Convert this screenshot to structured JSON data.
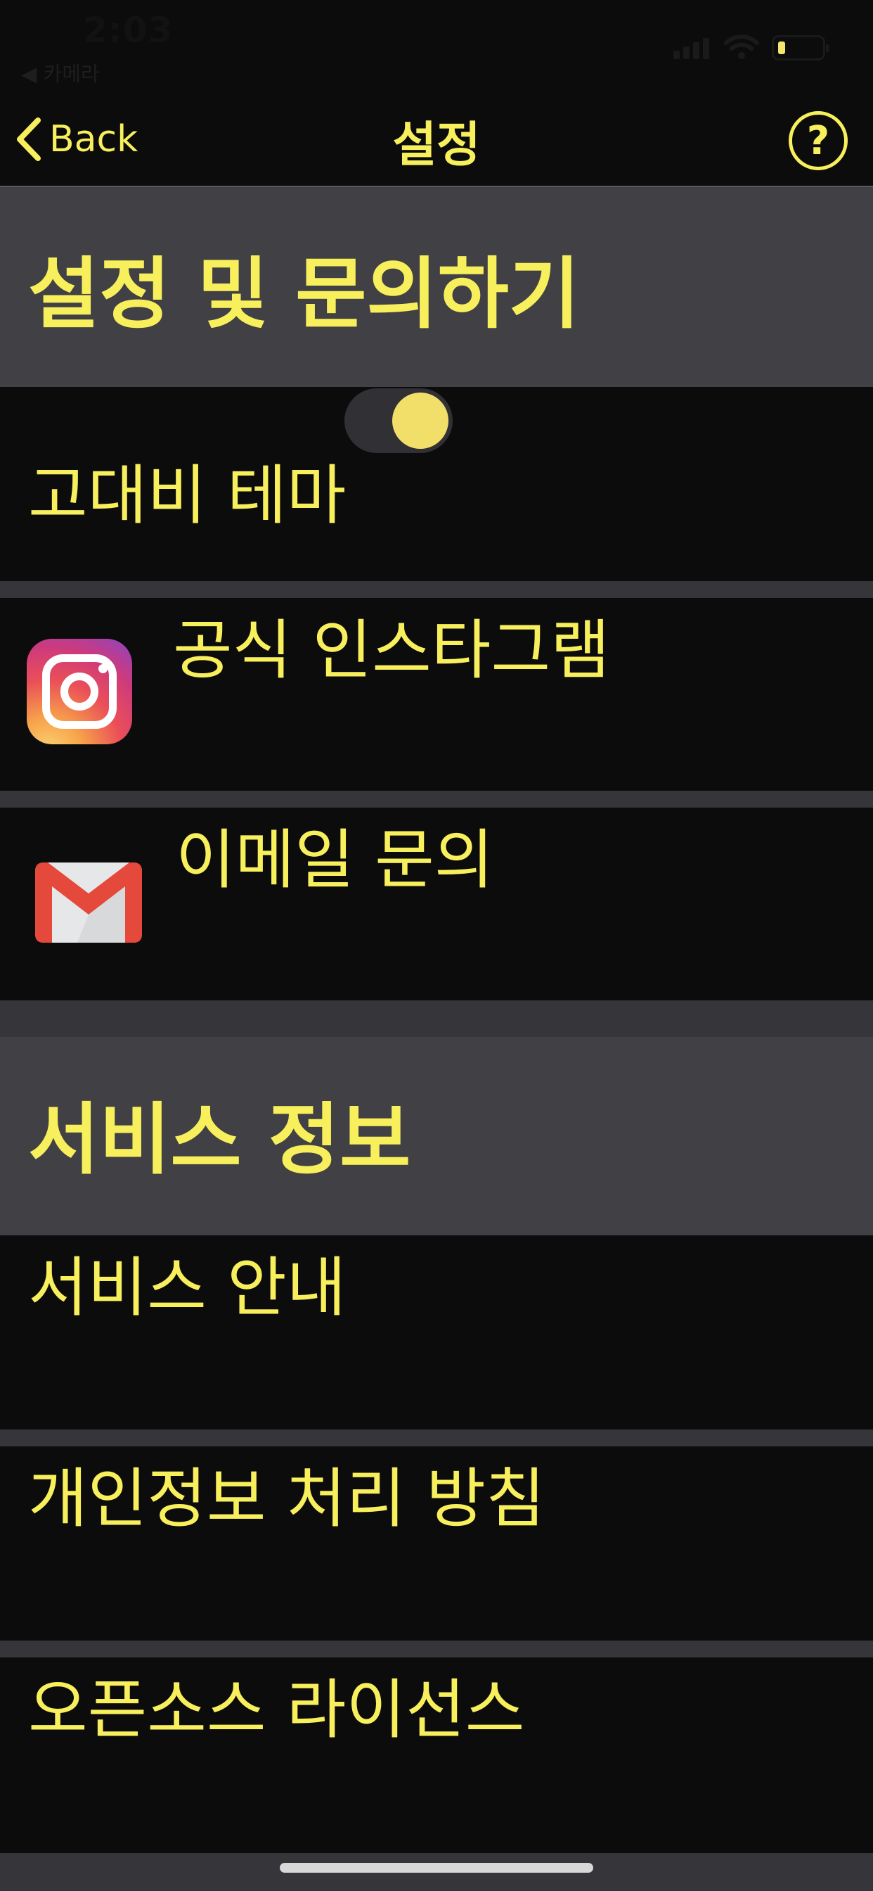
{
  "status_bar": {
    "time": "2:03",
    "back_app": "◀ 카메라"
  },
  "nav": {
    "back_label": "Back",
    "title": "설정",
    "help_symbol": "?"
  },
  "settings_section": {
    "title": "설정 및 문의하기",
    "high_contrast": {
      "label": "고대비 테마",
      "enabled": true
    },
    "instagram": {
      "label": "공식 인스타그램",
      "icon": "instagram-icon"
    },
    "email": {
      "label": "이메일 문의",
      "icon": "gmail-icon"
    }
  },
  "service_section": {
    "title": "서비스 정보",
    "items": [
      {
        "label": "서비스 안내"
      },
      {
        "label": "개인정보 처리 방침"
      },
      {
        "label": "오픈소스 라이선스"
      }
    ]
  },
  "colors": {
    "accent": "#f8ef5c",
    "background": "#0c0c0d",
    "section_header": "#414045",
    "separator": "#363539",
    "toggle_knob": "#f2df6a"
  }
}
